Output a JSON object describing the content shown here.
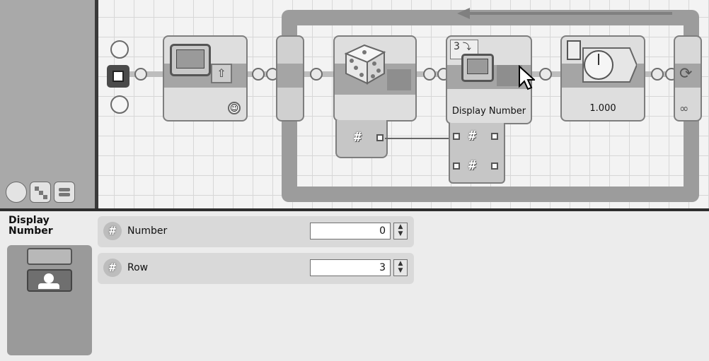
{
  "canvas": {
    "blocks": {
      "display_block": {
        "caption": "Display Number"
      },
      "wait_block": {
        "caption": "1.000"
      },
      "number_to_text": {
        "caption": "3"
      }
    },
    "loop_icon": "infinity-icon"
  },
  "palette": {
    "tabs": [
      "common-palette-icon",
      "complete-palette-icon",
      "custom-palette-icon"
    ]
  },
  "config": {
    "title": "Display Number",
    "rows": [
      {
        "label": "Number",
        "value": "0"
      },
      {
        "label": "Row",
        "value": "3"
      }
    ],
    "hash_glyph": "#"
  },
  "colors": {
    "canvas_grid": "#d7d7d7",
    "loop_frame": "#9c9c9c",
    "panel_bg": "#ececec",
    "palette_bg": "#a9a9a9"
  }
}
